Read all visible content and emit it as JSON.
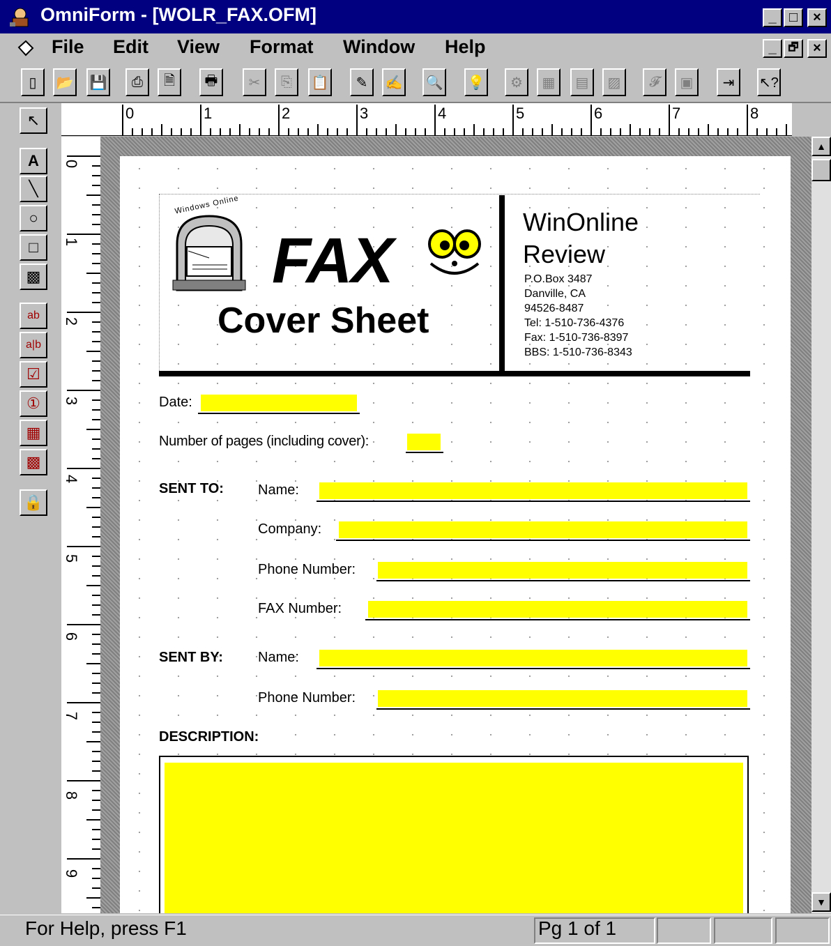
{
  "window": {
    "title": "OmniForm - [WOLR_FAX.OFM]",
    "controls": [
      "_",
      "□",
      "×"
    ],
    "doc_controls": [
      "_",
      "🗗",
      "×"
    ]
  },
  "menu": [
    "File",
    "Edit",
    "View",
    "Format",
    "Window",
    "Help"
  ],
  "ruler": {
    "horizontal": [
      "0",
      "1",
      "2",
      "3",
      "4",
      "5",
      "6",
      "7",
      "8"
    ],
    "vertical": [
      "0",
      "1",
      "2",
      "3",
      "4",
      "5",
      "6",
      "7",
      "8",
      "9"
    ]
  },
  "form": {
    "logo_caption": "Windows Online",
    "fax_word": "FAX",
    "cover_sheet": "Cover Sheet",
    "company_line1": "WinOnline",
    "company_line2": "Review",
    "address": [
      "P.O.Box 3487",
      "Danville, CA",
      "94526-8487",
      "Tel: 1-510-736-4376",
      "Fax: 1-510-736-8397",
      "BBS: 1-510-736-8343"
    ],
    "date_label": "Date:",
    "pages_label": "Number of pages (including cover):",
    "sent_to_label": "SENT TO:",
    "sent_to": {
      "name_label": "Name:",
      "company_label": "Company:",
      "phone_label": "Phone Number:",
      "fax_label": "FAX Number:"
    },
    "sent_by_label": "SENT BY:",
    "sent_by": {
      "name_label": "Name:",
      "phone_label": "Phone Number:"
    },
    "description_label": "DESCRIPTION:"
  },
  "status": {
    "help": "For Help, press F1",
    "page": "Pg 1 of 1"
  },
  "colors": {
    "title_bar": "#000080",
    "field_fill": "#ffff00"
  }
}
